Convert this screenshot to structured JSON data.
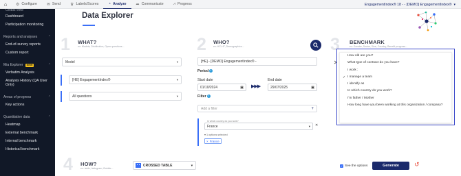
{
  "topbar": {
    "nav": [
      {
        "label": "Configure",
        "icon": "gear-icon"
      },
      {
        "label": "Send",
        "icon": "send-icon"
      },
      {
        "label": "Labels/Scores",
        "icon": "trophy-icon"
      },
      {
        "label": "Analyze",
        "icon": "analyze-icon",
        "active": true
      },
      {
        "label": "Communicate",
        "icon": "share-icon"
      },
      {
        "label": "Progress",
        "icon": "progress-chart-icon"
      }
    ],
    "project": "EngagementIndex® 18 - - [DEMO] EngagementIndex®"
  },
  "sidebar": {
    "top_cut": "Global view",
    "top_items": [
      "Dashboard",
      "Participation monitoring"
    ],
    "sections": [
      {
        "header": "Reports and analyses",
        "items": [
          "End-of-survey reports",
          "Custom report"
        ]
      },
      {
        "header": "Mia Explorer",
        "badge": "NEW",
        "items": [
          "Verbatim Analysis",
          "Analysis History (QA User Only)"
        ]
      },
      {
        "header": "Areas of progress",
        "items": [
          "Key actions"
        ]
      },
      {
        "header": "Quantitative data",
        "items": [
          "Heatmap",
          "External benchmark",
          "Internal benchmark",
          "Historical benchmark"
        ]
      }
    ]
  },
  "main": {
    "title": "Data Explorer",
    "what": {
      "number": "1",
      "title": "WHAT?",
      "subtitle": "ex: Models, Distribution, Open questions...",
      "model": "Model",
      "index": "[HE] EngagementIndex®",
      "questions": "All questions"
    },
    "who": {
      "number": "2",
      "title": "WHO?",
      "subtitle": "ex: HC-HT, Demographics...",
      "survey": "[HE] - [DEMO] EngagementIndex® -",
      "period_label": "Period",
      "start_label": "Start date",
      "start_value": "01/10/2024",
      "end_label": "End date",
      "end_value": "29/07/2025",
      "filter_label": "Filter",
      "filter_placeholder": "Add a filter",
      "country_question": "In which country do you work?",
      "country_value": "France",
      "options_selected": "1 options selected",
      "chip": "France"
    },
    "benchmark": {
      "number": "3",
      "title": "BENCHMARK",
      "subtitle": "ex: Gender, Sector, Size, Country, Benefit progress...",
      "options": [
        {
          "label": "How old are you?",
          "checked": false
        },
        {
          "label": "What type of contract do you have?",
          "checked": false
        },
        {
          "label": "I work :",
          "checked": false
        },
        {
          "label": "I manage a team",
          "checked": true
        },
        {
          "label": "I identify as",
          "checked": false
        },
        {
          "label": "In which country do you work?",
          "checked": false
        },
        {
          "label": "I'm father / Mother",
          "checked": false
        },
        {
          "label": "How long have you been working at this organization / company?",
          "checked": false
        }
      ]
    },
    "how": {
      "number": "4",
      "title": "HOW?",
      "subtitle": "ex: table, histogram, Bubble...",
      "display": "CROSSED TABLE",
      "see_options": "See the options",
      "generate": "Generate"
    }
  },
  "colors": {
    "navy": "#1b2a6b",
    "accent": "#3a6ff7",
    "sidebar_bg": "#111827"
  }
}
